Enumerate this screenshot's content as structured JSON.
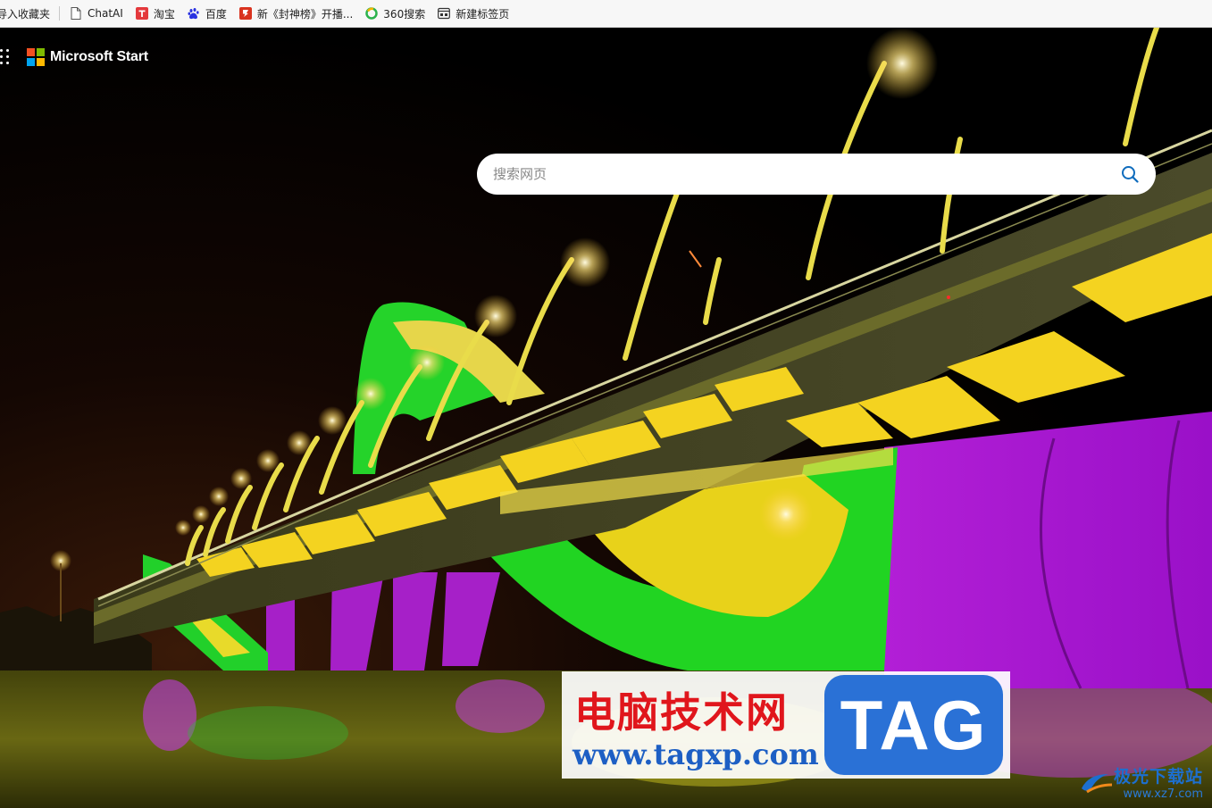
{
  "bookmarks_bar": {
    "items": [
      {
        "label": "导入收藏夹",
        "icon": "import-icon"
      },
      {
        "label": "ChatAI",
        "icon": "page-icon"
      },
      {
        "label": "淘宝",
        "icon": "taobao-icon",
        "color": "#e4393c"
      },
      {
        "label": "百度",
        "icon": "baidu-paw-icon",
        "color": "#2932e1"
      },
      {
        "label": "新《封神榜》开播...",
        "icon": "fengshen-icon",
        "color": "#d9331f"
      },
      {
        "label": "360搜索",
        "icon": "360-search-icon",
        "color": "#2bb24c"
      },
      {
        "label": "新建标签页",
        "icon": "new-tab-icon"
      }
    ]
  },
  "header": {
    "brand": "Microsoft Start",
    "logo_colors": [
      "#f25022",
      "#7fba00",
      "#00a4ef",
      "#ffb900"
    ]
  },
  "search": {
    "placeholder": "搜索网页",
    "value": "",
    "icon": "search-icon",
    "icon_color": "#0f6cbd"
  },
  "watermark": {
    "title": "电脑技术网",
    "url": "www.tagxp.com",
    "tag": "TAG",
    "secondary_title": "极光下载站",
    "secondary_url": "www.xz7.com"
  }
}
